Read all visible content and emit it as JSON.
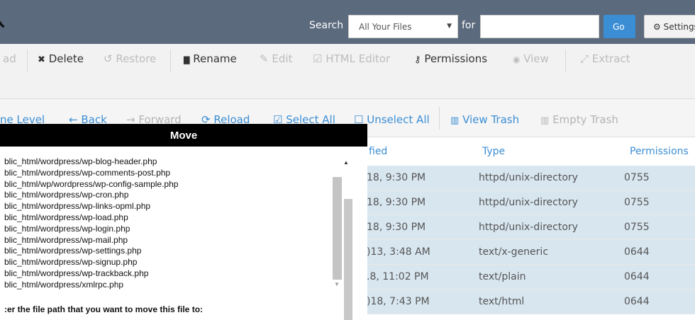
{
  "header": {
    "cursor_glyph": "⬉",
    "search_label": "Search",
    "search_scope": "All Your Files",
    "for_label": "for",
    "search_value": "",
    "go_label": "Go",
    "settings_label": "Settings"
  },
  "toolbar": {
    "items": [
      {
        "icon": "upload-icon",
        "label": "ad",
        "enabled": false
      },
      {
        "icon": "x-icon",
        "glyph": "✖",
        "label": "Delete",
        "enabled": true
      },
      {
        "icon": "restore-icon",
        "glyph": "↺",
        "label": "Restore",
        "enabled": false
      },
      {
        "icon": "file-icon",
        "glyph": "▇",
        "label": "Rename",
        "enabled": true
      },
      {
        "icon": "pencil-icon",
        "glyph": "✎",
        "label": "Edit",
        "enabled": false
      },
      {
        "icon": "html-editor-icon",
        "glyph": "☑",
        "label": "HTML Editor",
        "enabled": false
      },
      {
        "icon": "key-icon",
        "glyph": "🔑",
        "label": "Permissions",
        "enabled": true
      },
      {
        "icon": "eye-icon",
        "glyph": "◉",
        "label": "View",
        "enabled": false
      },
      {
        "icon": "extract-icon",
        "glyph": "⤢",
        "label": "Extract",
        "enabled": false
      }
    ]
  },
  "navbar": {
    "items": [
      {
        "icon": "",
        "glyph": "",
        "label": "ne Level",
        "enabled": true
      },
      {
        "icon": "arrow-left-icon",
        "glyph": "←",
        "label": "Back",
        "enabled": true
      },
      {
        "icon": "arrow-right-icon",
        "glyph": "→",
        "label": "Forward",
        "enabled": false
      },
      {
        "icon": "reload-icon",
        "glyph": "⟳",
        "label": "Reload",
        "enabled": true
      },
      {
        "icon": "checkbox-checked-icon",
        "glyph": "☑",
        "label": "Select All",
        "enabled": true
      },
      {
        "icon": "checkbox-empty-icon",
        "glyph": "☐",
        "label": "Unselect All",
        "enabled": true
      },
      {
        "icon": "trash-icon",
        "glyph": "🗑",
        "label": "View Trash",
        "enabled": true
      },
      {
        "icon": "trash-icon",
        "glyph": "🗑",
        "label": "Empty Trash",
        "enabled": false
      }
    ]
  },
  "table": {
    "columns": [
      "fied",
      "Type",
      "Permissions"
    ],
    "rows": [
      {
        "modified": "18, 9:30 PM",
        "type": "httpd/unix-directory",
        "perms": "0755",
        "selected": true
      },
      {
        "modified": "18, 9:30 PM",
        "type": "httpd/unix-directory",
        "perms": "0755",
        "selected": true
      },
      {
        "modified": "18, 9:30 PM",
        "type": "httpd/unix-directory",
        "perms": "0755",
        "selected": true
      },
      {
        "modified": ")13, 3:48 AM",
        "type": "text/x-generic",
        "perms": "0644",
        "selected": true
      },
      {
        "modified": ".8, 11:02 PM",
        "type": "text/plain",
        "perms": "0644",
        "selected": true
      },
      {
        "modified": ")18, 7:43 PM",
        "type": "text/html",
        "perms": "0644",
        "selected": true
      }
    ]
  },
  "modal": {
    "title": "Move",
    "files": [
      "blic_html/wordpress/wp-blog-header.php",
      "blic_html/wordpress/wp-comments-post.php",
      "blic_html/wp/wordpress/wp-config-sample.php",
      "blic_html/wordpress/wp-cron.php",
      "blic_html/wordpress/wp-links-opml.php",
      "blic_html/wordpress/wp-load.php",
      "blic_html/wordpress/wp-login.php",
      "blic_html/wordpress/wp-mail.php",
      "blic_html/wordpress/wp-settings.php",
      "blic_html/wordpress/wp-signup.php",
      "blic_html/wordpress/wp-trackback.php",
      "blic_html/wordpress/xmlrpc.php"
    ],
    "prompt": ":er the file path that you want to move this file to:"
  },
  "colors": {
    "header_bg": "#5b6a7d",
    "accent": "#3c8ed4",
    "row_selected": "#d8e6f0",
    "modal_title_bg": "#000000"
  }
}
